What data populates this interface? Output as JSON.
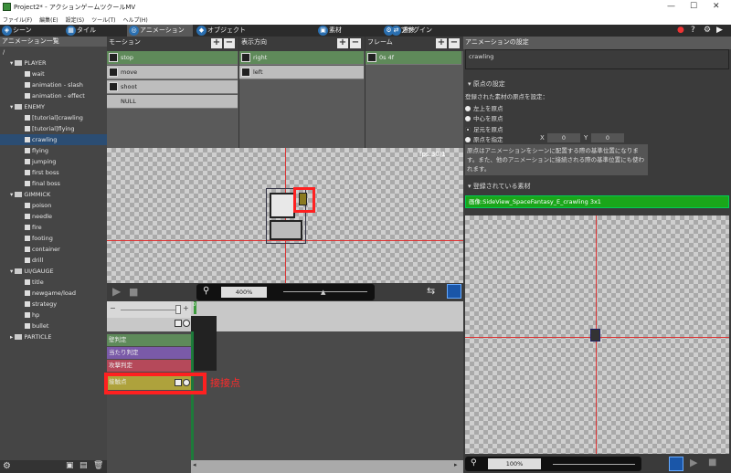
{
  "window": {
    "title": "Project2* - アクションゲームツクールMV",
    "controls": [
      "—",
      "☐",
      "✕"
    ]
  },
  "menu": [
    "ファイル(F)",
    "編集(E)",
    "設定(S)",
    "ツール(T)",
    "ヘルプ(H)"
  ],
  "tabs": [
    {
      "label": "シーン",
      "icon": "scene-icon"
    },
    {
      "label": "タイル",
      "icon": "tile-icon"
    },
    {
      "label": "アニメーション",
      "icon": "animation-icon"
    },
    {
      "label": "オブジェクト",
      "icon": "object-icon"
    },
    {
      "label": "素材",
      "icon": "resource-icon"
    },
    {
      "label": "遷移",
      "icon": "transition-icon"
    },
    {
      "label": "プラグイン",
      "icon": "plugin-icon"
    }
  ],
  "left_panel": {
    "title": "アニメーション一覧",
    "items": [
      {
        "label": "/",
        "kind": "root"
      },
      {
        "label": "PLAYER",
        "kind": "folder"
      },
      {
        "label": "wait",
        "kind": "anim"
      },
      {
        "label": "animation - slash",
        "kind": "anim"
      },
      {
        "label": "animation - effect",
        "kind": "anim"
      },
      {
        "label": "ENEMY",
        "kind": "folder"
      },
      {
        "label": "[tutorial]crawling",
        "kind": "anim"
      },
      {
        "label": "[tutorial]flying",
        "kind": "anim"
      },
      {
        "label": "crawling",
        "kind": "anim",
        "selected": true
      },
      {
        "label": "flying",
        "kind": "anim"
      },
      {
        "label": "jumping",
        "kind": "anim"
      },
      {
        "label": "first boss",
        "kind": "anim"
      },
      {
        "label": "final boss",
        "kind": "anim"
      },
      {
        "label": "GIMMICK",
        "kind": "folder"
      },
      {
        "label": "poison",
        "kind": "anim"
      },
      {
        "label": "needle",
        "kind": "anim"
      },
      {
        "label": "fire",
        "kind": "anim"
      },
      {
        "label": "footing",
        "kind": "anim"
      },
      {
        "label": "container",
        "kind": "anim"
      },
      {
        "label": "drill",
        "kind": "anim"
      },
      {
        "label": "UI/GAUGE",
        "kind": "folder"
      },
      {
        "label": "title",
        "kind": "anim"
      },
      {
        "label": "newgame/load",
        "kind": "anim"
      },
      {
        "label": "strategy",
        "kind": "anim"
      },
      {
        "label": "hp",
        "kind": "anim"
      },
      {
        "label": "bullet",
        "kind": "anim"
      },
      {
        "label": "PARTICLE",
        "kind": "folder-collapsed"
      }
    ]
  },
  "motion": {
    "title": "モーション",
    "items": [
      "stop",
      "move",
      "shoot",
      "NULL"
    ]
  },
  "direction": {
    "title": "表示方向",
    "items": [
      "right",
      "left"
    ]
  },
  "frame": {
    "title": "フレーム",
    "items": [
      "0s 4f"
    ]
  },
  "preview": {
    "fps": "fps:30/1",
    "zoom": "400%"
  },
  "timeline": {
    "tracks": [
      {
        "label": "壁判定",
        "color": "#5e8a5a"
      },
      {
        "label": "当たり判定",
        "color": "#7a5aa8"
      },
      {
        "label": "攻撃判定",
        "color": "#b5495a"
      },
      {
        "label": "接触点",
        "color": "#aea23c"
      }
    ],
    "frame_marker": "0"
  },
  "annotation": {
    "label": "接接点",
    "color": "#ff2a2a"
  },
  "settings": {
    "title": "アニメーションの設定",
    "name": "crawling",
    "origin_section": "原点の設定",
    "origin_prompt": "登録された素材の原点を設定：",
    "options": [
      "左上を原点",
      "中心を原点",
      "足元を原点",
      "原点を指定"
    ],
    "selected_option": "足元を原点",
    "x_label": "X",
    "x_value": "0",
    "y_label": "Y",
    "y_value": "0",
    "description": "原点はアニメーションをシーンに配置する際の基準位置になります。また、他のアニメーションに接続される際の基準位置にも使われます。",
    "registered_section": "登録されている素材",
    "resource": "画像:SideView_SpaceFantasy_E_crawling 3x1",
    "zoom": "100%"
  }
}
